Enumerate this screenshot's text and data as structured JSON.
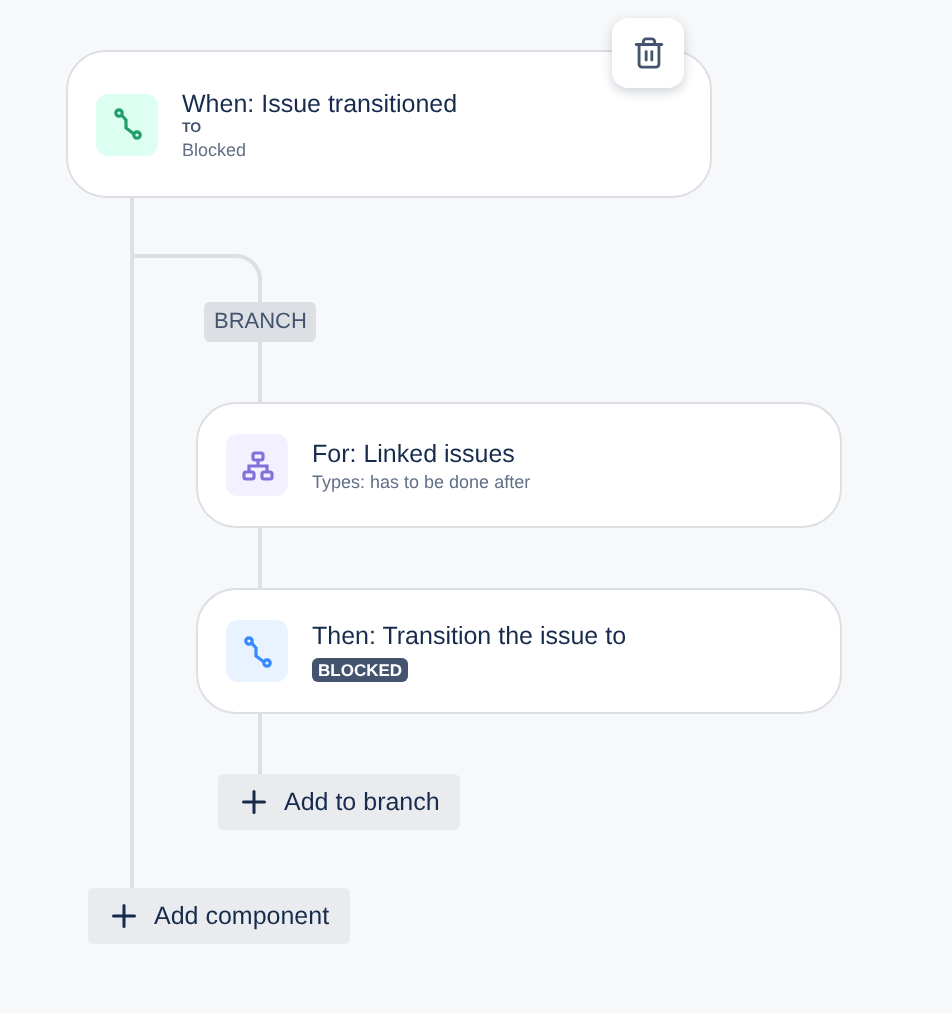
{
  "trigger": {
    "kind": "trigger",
    "title": "When: Issue transitioned",
    "label": "TO",
    "value": "Blocked"
  },
  "branch": {
    "badge": "BRANCH",
    "components": [
      {
        "kind": "branch",
        "title": "For: Linked issues",
        "subtitle": "Types: has to be done after"
      },
      {
        "kind": "action",
        "title": "Then: Transition the issue to",
        "lozenge": "BLOCKED"
      }
    ],
    "add_button": "Add to branch"
  },
  "add_button": "Add component"
}
